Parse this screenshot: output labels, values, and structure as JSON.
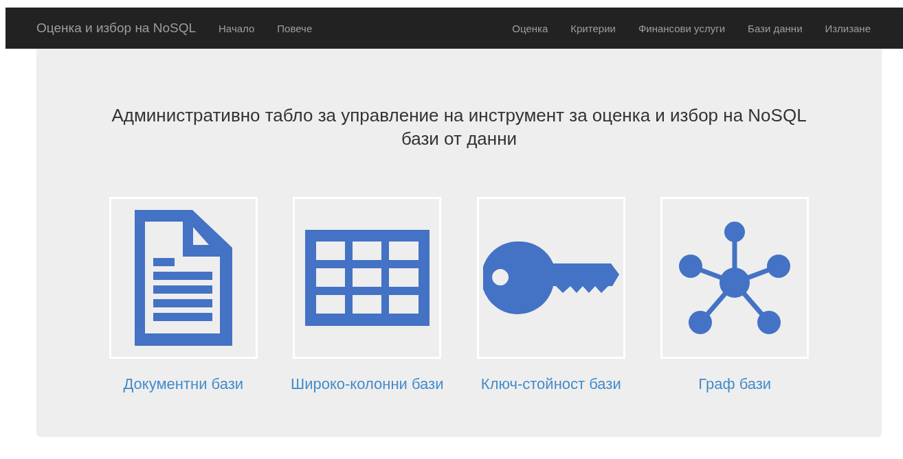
{
  "navbar": {
    "brand": "Оценка и избор на NoSQL",
    "left_links": [
      "Начало",
      "Повече"
    ],
    "right_links": [
      "Оценка",
      "Критерии",
      "Финансови услуги",
      "Бази данни",
      "Излизане"
    ]
  },
  "hero": {
    "heading": "Административно табло за управление на инструмент за оценка и избор на NoSQL бази от данни",
    "cards": [
      {
        "kind": "document",
        "label": "Документни бази"
      },
      {
        "kind": "table",
        "label": "Широко-колонни бази"
      },
      {
        "kind": "key",
        "label": "Ключ-стойност бази"
      },
      {
        "kind": "graph",
        "label": "Граф бази"
      }
    ]
  }
}
